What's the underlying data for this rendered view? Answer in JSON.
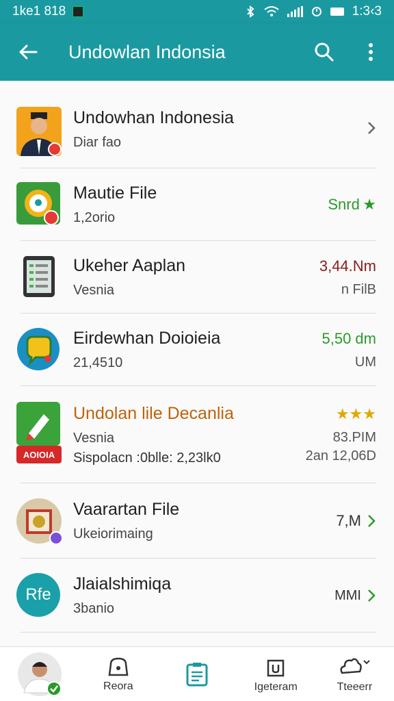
{
  "status_bar": {
    "left_text": "1ke1 818",
    "time": "1:3‹3"
  },
  "app_bar": {
    "title": "Undowlan Indonsia"
  },
  "list": [
    {
      "title": "Undowhan Indonesia",
      "subtitle": "Diar fao"
    },
    {
      "title": "Mautie File",
      "subtitle": "1,2orio",
      "meta1": "Snrd"
    },
    {
      "title": "Ukeher Aaplan",
      "subtitle": "Vesnia",
      "meta1": "3,44.Nm",
      "meta2": "n FilB"
    },
    {
      "title": "Eirdewhan Doioieia",
      "subtitle": "21,4510",
      "meta1": "5,50 dm",
      "meta2": "UM"
    },
    {
      "title": "Undolan lile Decanlia",
      "subtitle": "Vesnia",
      "subtitle2": "Sispolacn :0blle: 2,23lk0",
      "meta2": "83.PIM",
      "meta3": "2an 12,06D",
      "badge": "AOIOIA"
    },
    {
      "title": "Vaarartan File",
      "subtitle": "Ukeiorimaing",
      "meta1": "7,M"
    },
    {
      "title": "Jlaialshimiqa",
      "subtitle": "3banio",
      "meta1": "MMI",
      "avatar_text": "Rfe"
    }
  ],
  "bottom_nav": [
    {
      "label": ""
    },
    {
      "label": "Reora"
    },
    {
      "label": ""
    },
    {
      "label": "Igeteram"
    },
    {
      "label": "Tteeerr"
    }
  ],
  "colors": {
    "primary": "#1a9aa0",
    "accent_green": "#2a9a2a",
    "star_gold": "#e0a800",
    "price_red": "#8a1a1a",
    "title_orange": "#c0620a"
  }
}
